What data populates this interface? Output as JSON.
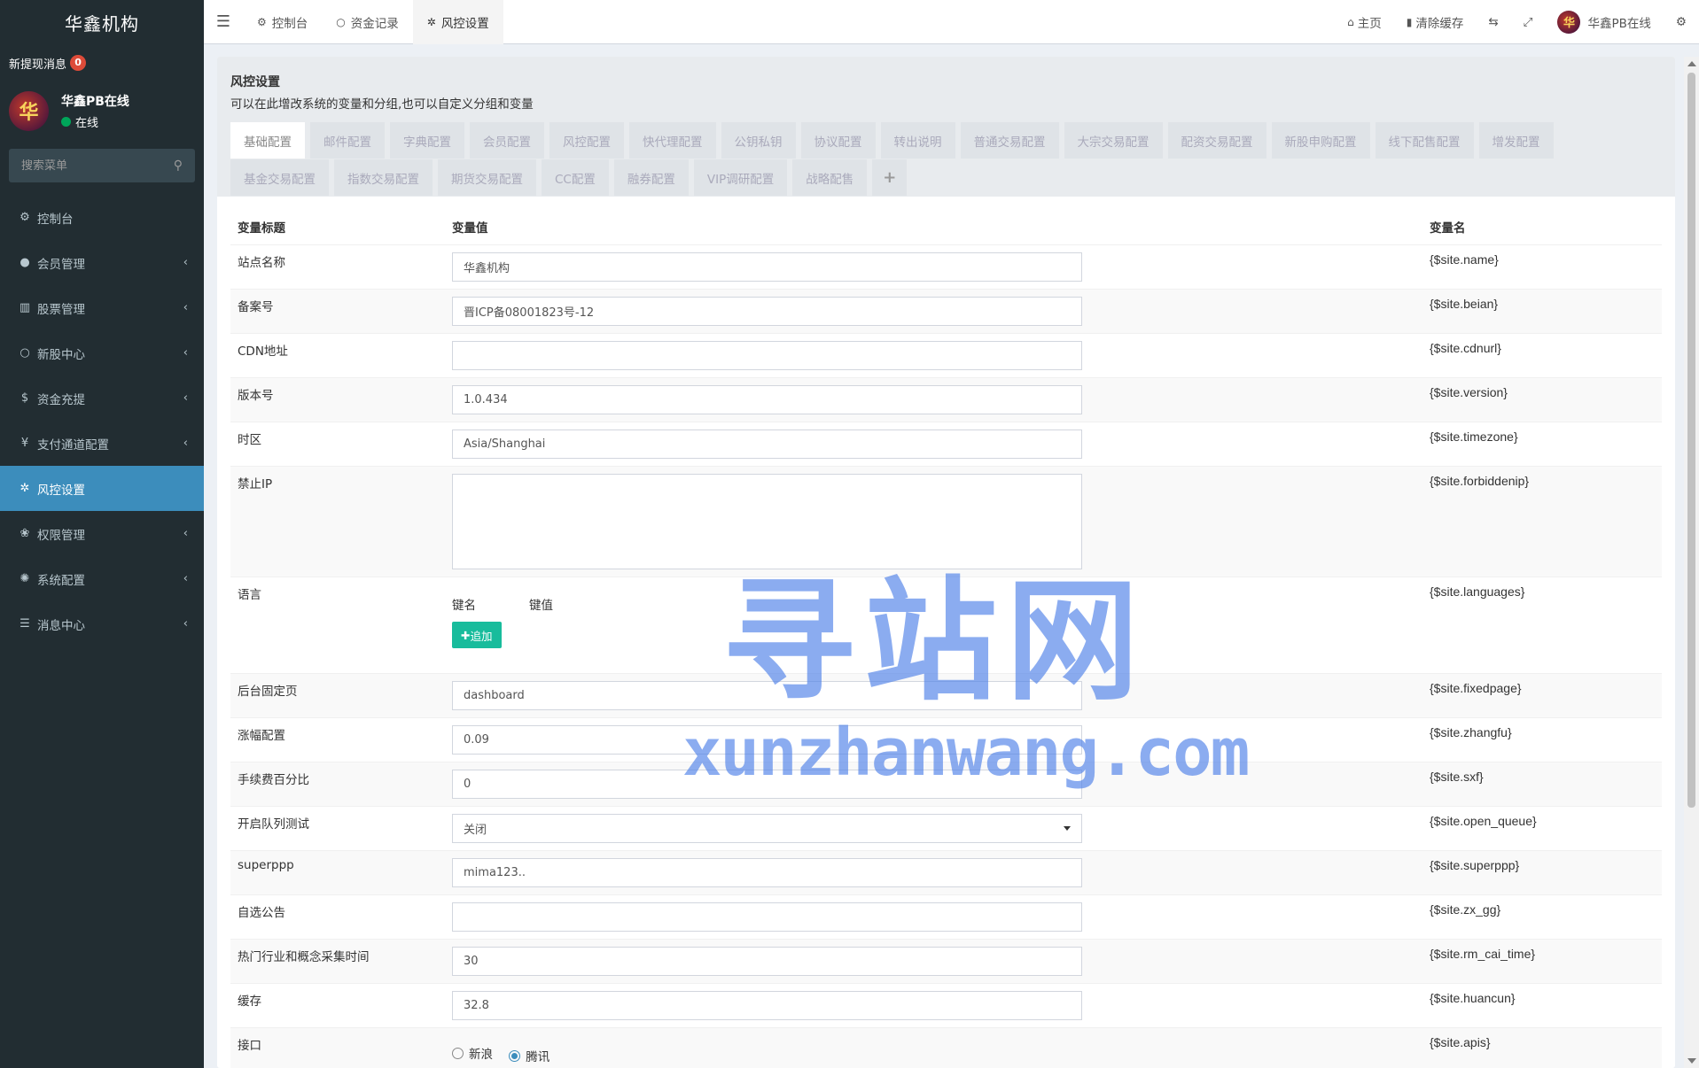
{
  "sidebar": {
    "logo": "华鑫机构",
    "notice_label": "新提现消息",
    "notice_count": "0",
    "user_name": "华鑫PB在线",
    "user_status": "在线",
    "avatar_glyph": "华",
    "search_placeholder": "搜索菜单",
    "items": [
      {
        "label": "控制台",
        "icon": "dashboard-icon",
        "glyph": "⚙"
      },
      {
        "label": "会员管理",
        "icon": "user-circle-icon",
        "glyph": "●"
      },
      {
        "label": "股票管理",
        "icon": "bank-icon",
        "glyph": "▥"
      },
      {
        "label": "新股中心",
        "icon": "circle-icon",
        "glyph": "○"
      },
      {
        "label": "资金充提",
        "icon": "dollar-icon",
        "glyph": "$"
      },
      {
        "label": "支付通道配置",
        "icon": "yen-icon",
        "glyph": "¥"
      },
      {
        "label": "风控设置",
        "icon": "gear-icon",
        "glyph": "✲"
      },
      {
        "label": "权限管理",
        "icon": "users-icon",
        "glyph": "❀"
      },
      {
        "label": "系统配置",
        "icon": "cog-icon",
        "glyph": "✺"
      },
      {
        "label": "消息中心",
        "icon": "list-icon",
        "glyph": "☰"
      }
    ],
    "chevron": "‹"
  },
  "topnav": {
    "menu_glyph": "☰",
    "tabs": [
      {
        "label": "控制台",
        "glyph": "⚙"
      },
      {
        "label": "资金记录",
        "glyph": "○"
      },
      {
        "label": "风控设置",
        "glyph": "✲"
      }
    ],
    "home_label": "主页",
    "home_glyph": "⌂",
    "clear_cache_label": "清除缓存",
    "clear_cache_glyph": "▮",
    "translate_glyph": "⇆",
    "fullscreen_glyph": "⤢",
    "user_name": "华鑫PB在线",
    "settings_glyph": "⚙"
  },
  "panel": {
    "title": "风控设置",
    "description": "可以在此增改系统的变量和分组,也可以自定义分组和变量",
    "tabs": [
      "基础配置",
      "邮件配置",
      "字典配置",
      "会员配置",
      "风控配置",
      "快代理配置",
      "公钥私钥",
      "协议配置",
      "转出说明",
      "普通交易配置",
      "大宗交易配置",
      "配资交易配置",
      "新股申购配置",
      "线下配售配置",
      "增发配置",
      "基金交易配置",
      "指数交易配置",
      "期货交易配置",
      "CC配置",
      "融券配置",
      "VIP调研配置",
      "战略配售"
    ],
    "add_tab_glyph": "+"
  },
  "table": {
    "headers": {
      "title": "变量标题",
      "value": "变量值",
      "name": "变量名"
    },
    "rows": {
      "name": {
        "title": "站点名称",
        "value": "华鑫机构",
        "var": "{$site.name}"
      },
      "beian": {
        "title": "备案号",
        "value": "晋ICP备08001823号-12",
        "var": "{$site.beian}"
      },
      "cdnurl": {
        "title": "CDN地址",
        "value": "",
        "var": "{$site.cdnurl}"
      },
      "version": {
        "title": "版本号",
        "value": "1.0.434",
        "var": "{$site.version}"
      },
      "timezone": {
        "title": "时区",
        "value": "Asia/Shanghai",
        "var": "{$site.timezone}"
      },
      "forbiddenip": {
        "title": "禁止IP",
        "value": "",
        "var": "{$site.forbiddenip}"
      },
      "languages": {
        "title": "语言",
        "key_label": "键名",
        "val_label": "键值",
        "add_button": "追加",
        "var": "{$site.languages}"
      },
      "fixedpage": {
        "title": "后台固定页",
        "value": "dashboard",
        "var": "{$site.fixedpage}"
      },
      "zhangfu": {
        "title": "涨幅配置",
        "value": "0.09",
        "var": "{$site.zhangfu}"
      },
      "sxf": {
        "title": "手续费百分比",
        "value": "0",
        "var": "{$site.sxf}"
      },
      "open_queue": {
        "title": "开启队列测试",
        "value": "关闭",
        "var": "{$site.open_queue}"
      },
      "superppp": {
        "title": "superppp",
        "value": "mima123..",
        "var": "{$site.superppp}"
      },
      "zx_gg": {
        "title": "自选公告",
        "value": "",
        "var": "{$site.zx_gg}"
      },
      "rm_cai_time": {
        "title": "热门行业和概念采集时间",
        "value": "30",
        "var": "{$site.rm_cai_time}"
      },
      "huancun": {
        "title": "缓存",
        "value": "32.8",
        "var": "{$site.huancun}"
      },
      "apis": {
        "title": "接口",
        "options": [
          "新浪",
          "腾讯"
        ],
        "selected": "腾讯",
        "var": "{$site.apis}"
      }
    }
  },
  "watermark": {
    "cn": "寻站网",
    "en": "xunzhanwang.com"
  },
  "colors": {
    "sidebar_bg": "#222d32",
    "active_blue": "#3c8dbc",
    "add_button": "#18bc9c",
    "badge_red": "#dd4b39",
    "online_green": "#00a65a"
  }
}
